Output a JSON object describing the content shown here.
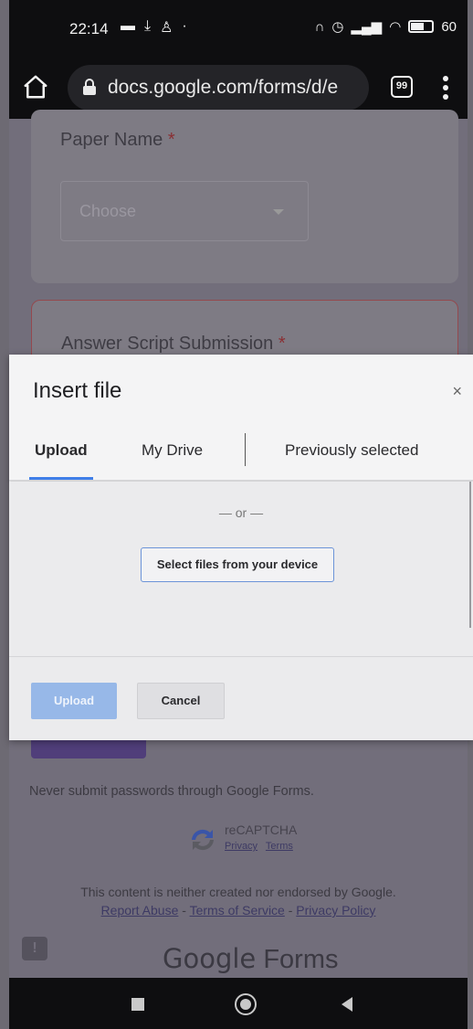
{
  "status_bar": {
    "time": "22:14",
    "battery": "60"
  },
  "browser": {
    "url": "docs.google.com/forms/d/e",
    "tab_count": "99"
  },
  "form": {
    "paper_name_label": "Paper Name",
    "required_mark": "*",
    "choose_placeholder": "Choose",
    "answer_script_label": "Answer Script Submission",
    "never_submit": "Never submit passwords through Google Forms.",
    "recaptcha": {
      "title": "reCAPTCHA",
      "privacy": "Privacy",
      "terms": "Terms"
    },
    "disclaimer": "This content is neither created nor endorsed by Google.",
    "links": {
      "report_abuse": "Report Abuse",
      "terms_of_service": "Terms of Service",
      "privacy_policy": "Privacy Policy",
      "separator": " - "
    },
    "logo_google": "Google",
    "logo_forms": "Forms"
  },
  "dialog": {
    "title": "Insert file",
    "close": "×",
    "tabs": [
      {
        "label": "Upload",
        "active": true
      },
      {
        "label": "My Drive",
        "active": false
      },
      {
        "label": "Previously selected",
        "active": false
      }
    ],
    "or_text": "— or —",
    "select_files": "Select files from your device",
    "upload_button": "Upload",
    "cancel_button": "Cancel"
  },
  "colors": {
    "accent_blue": "#3f7ee8",
    "submit_purple": "#503e7a"
  }
}
